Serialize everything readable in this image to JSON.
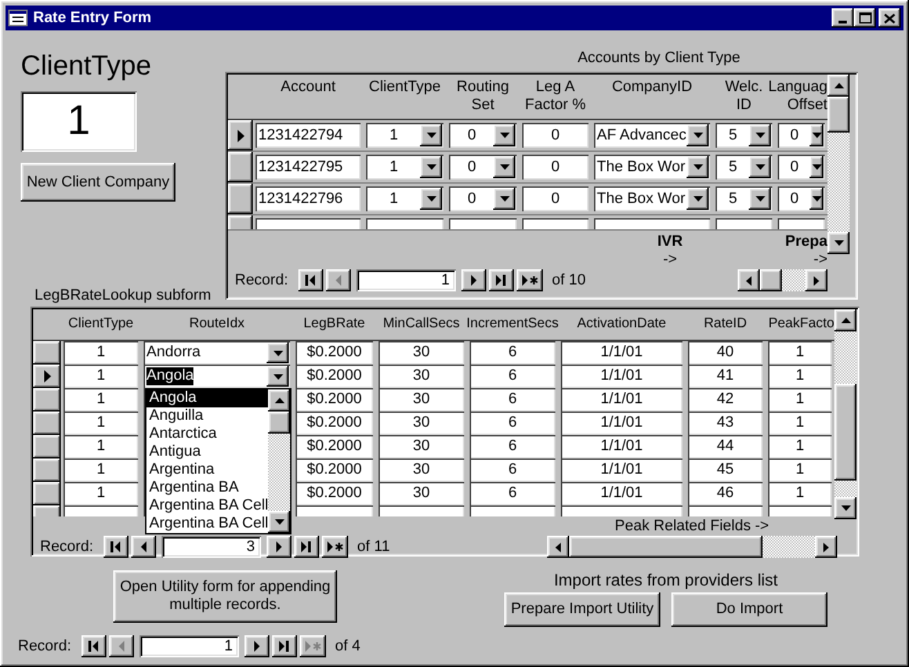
{
  "window": {
    "title": "Rate Entry Form"
  },
  "client_type": {
    "label": "ClientType",
    "value": "1"
  },
  "new_client_button": {
    "label": "New Client Company"
  },
  "accounts": {
    "title": "Accounts by Client Type",
    "columns": [
      {
        "label": "Account",
        "kind": "id"
      },
      {
        "label": "ClientType",
        "kind": "list"
      },
      {
        "label": "Routing\nSet",
        "kind": "list"
      },
      {
        "label": "Leg A\nFactor %",
        "kind": "num"
      },
      {
        "label": "CompanyID",
        "kind": "lookup"
      },
      {
        "label": "Welc.\nID",
        "kind": "list"
      },
      {
        "label": "Languag\nOffset",
        "kind": "list"
      }
    ],
    "rows": [
      {
        "current": true,
        "cells": [
          "1231422794",
          "1",
          "0",
          "0",
          "AF Advancec",
          "5",
          "0"
        ]
      },
      {
        "current": false,
        "cells": [
          "1231422795",
          "1",
          "0",
          "0",
          "The Box Wor",
          "5",
          "0"
        ]
      },
      {
        "current": false,
        "cells": [
          "1231422796",
          "1",
          "0",
          "0",
          "The Box Wor",
          "5",
          "0"
        ]
      }
    ],
    "footer_labels": [
      {
        "title": "IVR",
        "arrow": "->"
      },
      {
        "title": "Prepa",
        "arrow": "->"
      }
    ],
    "record_nav": {
      "label": "Record:",
      "value": "1",
      "total": "of 10",
      "buttons": [
        {
          "kind": "first",
          "disabled": false
        },
        {
          "kind": "previous",
          "disabled": true
        },
        {
          "kind": "next",
          "disabled": false
        },
        {
          "kind": "last",
          "disabled": false
        },
        {
          "kind": "new",
          "disabled": false
        }
      ]
    }
  },
  "legb": {
    "title": "LegBRateLookup subform",
    "columns": [
      "ClientType",
      "RouteIdx",
      "LegBRate",
      "MinCallSecs",
      "IncrementSecs",
      "ActivationDate",
      "RateID",
      "PeakFacto"
    ],
    "rows": [
      {
        "current": false,
        "highlighted": false,
        "client_type": "1",
        "route": "Andorra",
        "rate": "$0.2000",
        "min_secs": "30",
        "inc_secs": "6",
        "date": "1/1/01",
        "rate_id": "40",
        "peak": "1"
      },
      {
        "current": true,
        "highlighted": true,
        "client_type": "1",
        "route": "Angola",
        "rate": "$0.2000",
        "min_secs": "30",
        "inc_secs": "6",
        "date": "1/1/01",
        "rate_id": "41",
        "peak": "1"
      },
      {
        "current": false,
        "client_type": "1",
        "rate": "$0.2000",
        "min_secs": "30",
        "inc_secs": "6",
        "date": "1/1/01",
        "rate_id": "42",
        "peak": "1"
      },
      {
        "current": false,
        "client_type": "1",
        "rate": "$0.2000",
        "min_secs": "30",
        "inc_secs": "6",
        "date": "1/1/01",
        "rate_id": "43",
        "peak": "1"
      },
      {
        "current": false,
        "client_type": "1",
        "rate": "$0.2000",
        "min_secs": "30",
        "inc_secs": "6",
        "date": "1/1/01",
        "rate_id": "44",
        "peak": "1"
      },
      {
        "current": false,
        "client_type": "1",
        "rate": "$0.2000",
        "min_secs": "30",
        "inc_secs": "6",
        "date": "1/1/01",
        "rate_id": "45",
        "peak": "1"
      },
      {
        "current": false,
        "client_type": "1",
        "rate": "$0.2000",
        "min_secs": "30",
        "inc_secs": "6",
        "date": "1/1/01",
        "rate_id": "46",
        "peak": "1"
      }
    ],
    "dropdown": [
      {
        "label": "Angola",
        "selected": true
      },
      {
        "label": "Anguilla",
        "selected": false
      },
      {
        "label": "Antarctica",
        "selected": false
      },
      {
        "label": "Antigua",
        "selected": false
      },
      {
        "label": "Argentina",
        "selected": false
      },
      {
        "label": "Argentina BA",
        "selected": false
      },
      {
        "label": "Argentina BA Cell",
        "selected": false
      },
      {
        "label": "Argentina BA Cell",
        "selected": false
      }
    ],
    "footer_label": "Peak Related Fields ->",
    "record_nav": {
      "label": "Record:",
      "value": "3",
      "total": "of 11",
      "buttons": [
        {
          "kind": "first",
          "disabled": false
        },
        {
          "kind": "previous",
          "disabled": false
        },
        {
          "kind": "next",
          "disabled": false
        },
        {
          "kind": "last",
          "disabled": false
        },
        {
          "kind": "new",
          "disabled": false
        }
      ]
    }
  },
  "bottom": {
    "utility_button": "Open Utility form for appending multiple records.",
    "import_title": "Import rates from providers list",
    "buttons": [
      {
        "label": "Prepare Import Utility"
      },
      {
        "label": "Do Import"
      }
    ],
    "record_nav": {
      "label": "Record:",
      "value": "1",
      "total": "of 4",
      "buttons": [
        {
          "kind": "first",
          "disabled": false
        },
        {
          "kind": "previous",
          "disabled": true
        },
        {
          "kind": "next",
          "disabled": false
        },
        {
          "kind": "last",
          "disabled": false
        },
        {
          "kind": "new",
          "disabled": true
        }
      ]
    }
  }
}
